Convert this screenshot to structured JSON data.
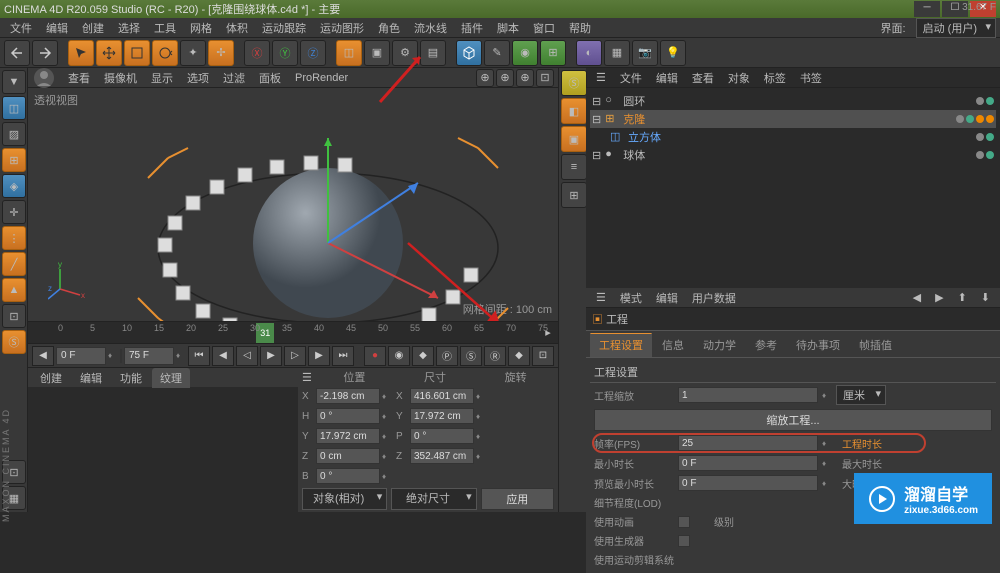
{
  "titlebar": {
    "title": "CINEMA 4D R20.059 Studio (RC - R20) - [克隆围绕球体.c4d *] - 主要"
  },
  "menubar": {
    "items": [
      "文件",
      "编辑",
      "创建",
      "选择",
      "工具",
      "网格",
      "体积",
      "运动跟踪",
      "运动图形",
      "角色",
      "流水线",
      "插件",
      "脚本",
      "窗口",
      "帮助"
    ],
    "layout_label": "界面:",
    "layout_value": "启动 (用户)"
  },
  "viewport_header": {
    "items": [
      "查看",
      "摄像机",
      "显示",
      "选项",
      "过滤",
      "面板",
      "ProRender"
    ]
  },
  "viewport": {
    "label": "透视视图",
    "grid_info": "网格间距 : 100 cm"
  },
  "timeline": {
    "left_frame": "0 F",
    "right_frame": "75 F",
    "current": "31.67 F",
    "marker": "31",
    "ticks": [
      "0",
      "5",
      "10",
      "15",
      "20",
      "25",
      "30",
      "35",
      "40",
      "45",
      "50",
      "55",
      "60",
      "65",
      "70",
      "75"
    ]
  },
  "bottom_tabs": {
    "items": [
      "创建",
      "编辑",
      "功能",
      "纹理"
    ],
    "active": 3
  },
  "coord": {
    "headers": [
      "位置",
      "尺寸",
      "旋转"
    ],
    "x_pos": "-2.198 cm",
    "x_size": "416.601 cm",
    "h_rot": "0 °",
    "y_pos": "17.972 cm",
    "y_size": "17.972 cm",
    "p_rot": "0 °",
    "z_pos": "0 cm",
    "z_size": "352.487 cm",
    "b_rot": "0 °",
    "mode1": "对象(相对)",
    "mode2": "绝对尺寸",
    "apply": "应用"
  },
  "obj_tabs": {
    "items": [
      "文件",
      "编辑",
      "查看",
      "对象",
      "标签",
      "书签"
    ]
  },
  "tree": {
    "items": [
      {
        "name": "圆环",
        "icon": "circle",
        "indent": 0
      },
      {
        "name": "克隆",
        "icon": "cloner",
        "indent": 0,
        "selected": true
      },
      {
        "name": "立方体",
        "icon": "cube",
        "indent": 1
      },
      {
        "name": "球体",
        "icon": "sphere",
        "indent": 0
      }
    ]
  },
  "attr_header": {
    "items": [
      "模式",
      "编辑",
      "用户数据"
    ]
  },
  "attr_breadcrumb": "工程",
  "attr_tabs": {
    "items": [
      "工程设置",
      "信息",
      "动力学",
      "参考",
      "待办事项",
      "帧插值"
    ],
    "active": 0
  },
  "section_title": "工程设置",
  "attrs": {
    "scale_label": "工程缩放",
    "scale_value": "1",
    "scale_unit": "厘米",
    "scale_btn": "缩放工程...",
    "fps_label": "帧率(FPS)",
    "fps_value": "25",
    "fps_right": "工程时长",
    "min_label": "最小时长",
    "min_value": "0 F",
    "max_label": "最大时长",
    "preview_label": "预览最小时长",
    "preview_value": "0 F",
    "preview_right": "大时长",
    "lod_label": "细节程度(LOD)",
    "anim_label": "使用动画",
    "anim_right": "级别",
    "gen_label": "使用生成器",
    "motion_label": "使用运动剪辑系统"
  },
  "watermark": {
    "main": "溜溜自学",
    "sub": "zixue.3d66.com"
  }
}
